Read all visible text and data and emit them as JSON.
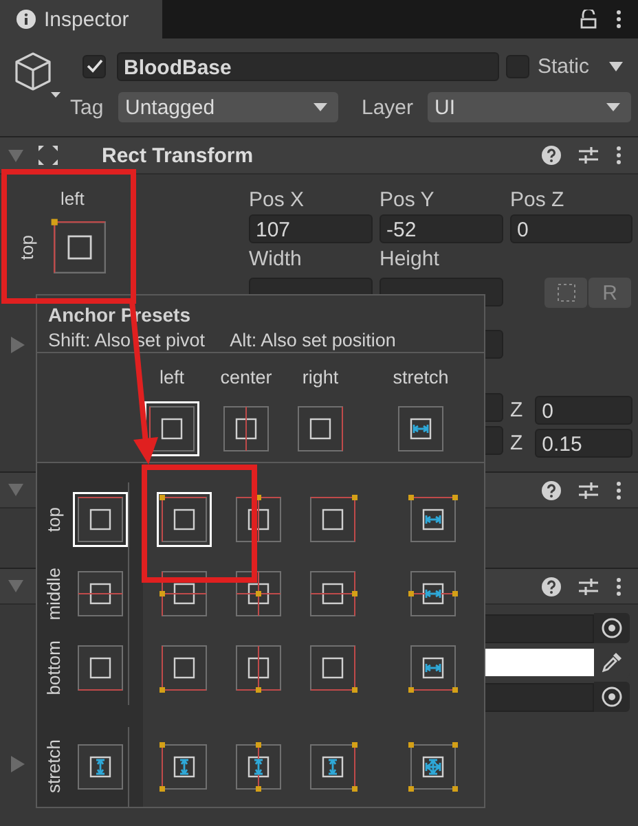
{
  "inspector_tab": {
    "title": "Inspector"
  },
  "game_object": {
    "active": true,
    "name": "BloodBase",
    "static": false,
    "static_label": "Static",
    "tag_label": "Tag",
    "tag": "Untagged",
    "layer_label": "Layer",
    "layer": "UI"
  },
  "rect_transform": {
    "title": "Rect Transform",
    "expanded": true,
    "anchor": {
      "h_label": "left",
      "v_label": "top"
    },
    "position": [
      {
        "label": "Pos X",
        "value": "107"
      },
      {
        "label": "Pos Y",
        "value": "-52"
      },
      {
        "label": "Pos Z",
        "value": "0"
      }
    ],
    "size_labels": [
      "Width",
      "Height"
    ],
    "raw_edit_button": "R",
    "foldout_expanded": false,
    "z_rows": [
      {
        "label": "Z",
        "value": "0"
      },
      {
        "label": "Z",
        "value": "0.15"
      }
    ]
  },
  "components": [
    {
      "expanded": true
    },
    {
      "expanded": true,
      "fields": [
        {
          "kind": "object"
        },
        {
          "kind": "color",
          "color": "#ffffff"
        },
        {
          "kind": "object"
        }
      ],
      "foldout_expanded": false
    }
  ],
  "anchor_presets": {
    "title": "Anchor Presets",
    "hints": [
      "Shift: Also set pivot",
      "Alt: Also set position"
    ],
    "columns": [
      {
        "label": "left",
        "selected": true
      },
      {
        "label": "center",
        "selected": false
      },
      {
        "label": "right",
        "selected": false
      },
      {
        "label": "stretch",
        "selected": false
      }
    ],
    "rows": [
      {
        "label": "top",
        "selected": true,
        "cells": [
          {
            "selected": true
          },
          {
            "selected": false
          },
          {
            "selected": false
          },
          {
            "selected": false
          }
        ]
      },
      {
        "label": "middle",
        "selected": false,
        "cells": [
          {
            "selected": false
          },
          {
            "selected": false
          },
          {
            "selected": false
          },
          {
            "selected": false
          }
        ]
      },
      {
        "label": "bottom",
        "selected": false,
        "cells": [
          {
            "selected": false
          },
          {
            "selected": false
          },
          {
            "selected": false
          },
          {
            "selected": false
          }
        ]
      },
      {
        "label": "stretch",
        "selected": false,
        "cells": [
          {
            "selected": false
          },
          {
            "selected": false
          },
          {
            "selected": false
          },
          {
            "selected": false
          }
        ]
      }
    ]
  }
}
